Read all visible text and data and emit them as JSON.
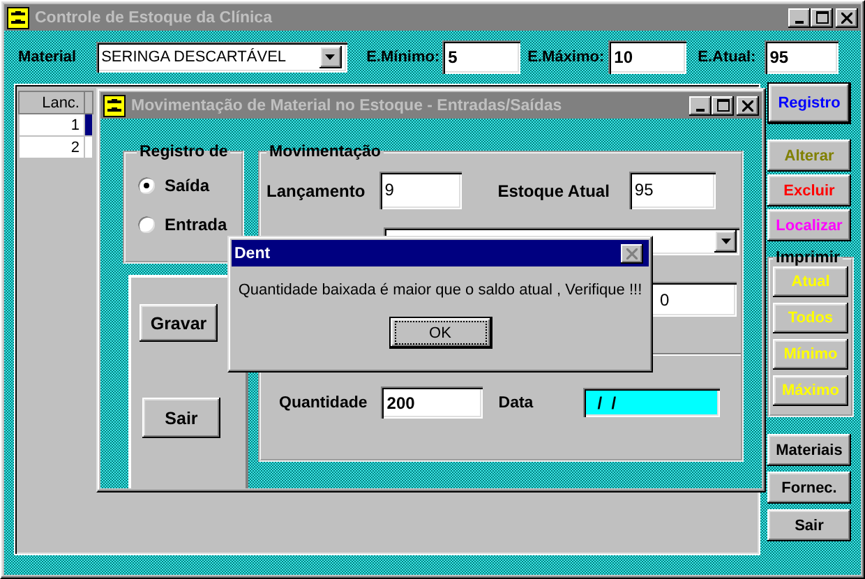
{
  "main_window": {
    "title": "Controle de Estoque da Clínica"
  },
  "material": {
    "label": "Material",
    "value": "SERINGA DESCARTÁVEL"
  },
  "stock_fields": [
    {
      "label": "E.Mínimo:",
      "value": "5"
    },
    {
      "label": "E.Máximo:",
      "value": "10"
    },
    {
      "label": "E.Atual:",
      "value": "95"
    }
  ],
  "grid": {
    "columns": [
      "Lanc."
    ],
    "rows": [
      {
        "cells": [
          "1"
        ],
        "selected": true
      },
      {
        "cells": [
          "2"
        ],
        "selected": false
      }
    ]
  },
  "side_buttons": [
    {
      "label": "Registro",
      "color": "#0000ff",
      "default": true
    },
    {
      "label": "Alterar",
      "color": "#808000",
      "default": false
    },
    {
      "label": "Excluir",
      "color": "#ff0000",
      "default": false
    },
    {
      "label": "Localizar",
      "color": "#ff00ff",
      "default": false
    }
  ],
  "print_group": {
    "title": "Imprimir",
    "buttons": [
      "Atual",
      "Todos",
      "Mínimo",
      "Máximo"
    ]
  },
  "bottom_buttons": [
    "Materiais",
    "Fornec.",
    "Sair"
  ],
  "child_window": {
    "title": "Movimentação de Material no Estoque - Entradas/Saídas"
  },
  "registro_group": {
    "title": "Registro de",
    "options": [
      {
        "label": "Saída",
        "selected": true
      },
      {
        "label": "Entrada",
        "selected": false
      }
    ]
  },
  "action_buttons": [
    "Gravar",
    "Sair"
  ],
  "movimentacao": {
    "title": "Movimentação",
    "lancamento": {
      "label": "Lançamento",
      "value": "9"
    },
    "estoque_atual": {
      "label": "Estoque Atual",
      "value": "95"
    },
    "field_3": {
      "value": "0"
    },
    "quantidade": {
      "label": "Quantidade",
      "value": "200"
    },
    "data": {
      "label": "Data",
      "value": "/  /"
    }
  },
  "dialog": {
    "title": "Dent",
    "message": "Quantidade baixada é maior que o saldo atual , Verifique !!!",
    "button": "OK"
  }
}
